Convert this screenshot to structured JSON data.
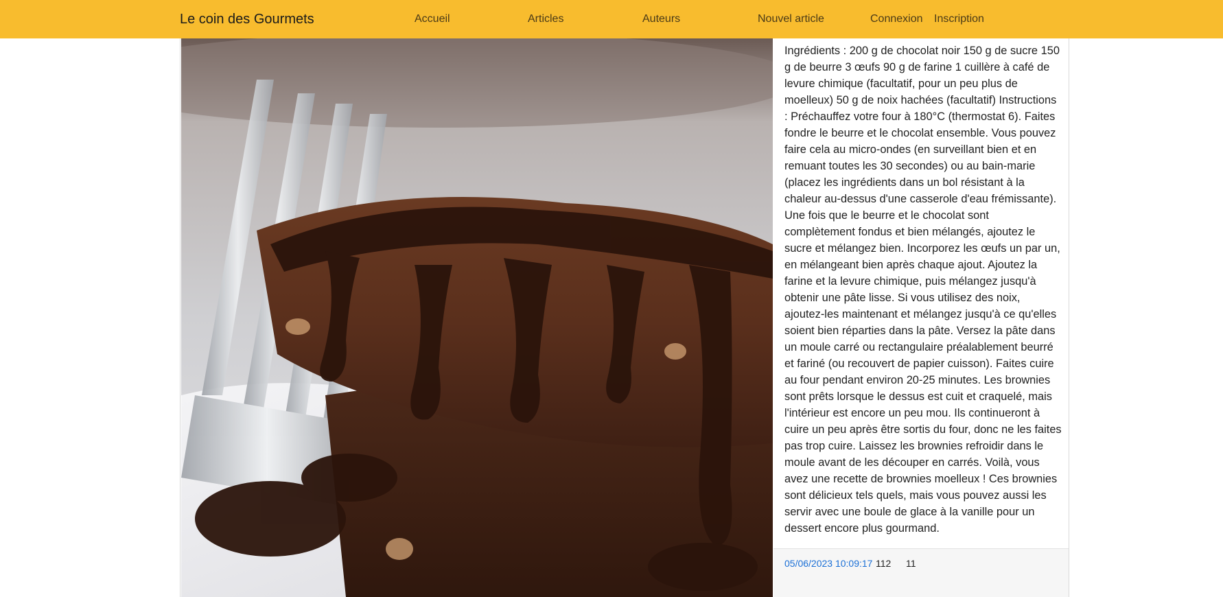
{
  "navbar": {
    "brand": "Le coin des Gourmets",
    "links": [
      {
        "label": "Accueil"
      },
      {
        "label": "Articles"
      },
      {
        "label": "Auteurs"
      },
      {
        "label": "Nouvel article"
      },
      {
        "label": "Connexion"
      },
      {
        "label": "Inscription"
      }
    ],
    "background_color": "#f8bc2e"
  },
  "article": {
    "image": {
      "subject": "chocolate brownies with melted chocolate sauce"
    },
    "body": "Ingrédients : 200 g de chocolat noir 150 g de sucre 150 g de beurre 3 œufs 90 g de farine 1 cuillère à café de levure chimique (facultatif, pour un peu plus de moelleux) 50 g de noix hachées (facultatif) Instructions : Préchauffez votre four à 180°C (thermostat 6). Faites fondre le beurre et le chocolat ensemble. Vous pouvez faire cela au micro-ondes (en surveillant bien et en remuant toutes les 30 secondes) ou au bain-marie (placez les ingrédients dans un bol résistant à la chaleur au-dessus d'une casserole d'eau frémissante). Une fois que le beurre et le chocolat sont complètement fondus et bien mélangés, ajoutez le sucre et mélangez bien. Incorporez les œufs un par un, en mélangeant bien après chaque ajout. Ajoutez la farine et la levure chimique, puis mélangez jusqu'à obtenir une pâte lisse. Si vous utilisez des noix, ajoutez-les maintenant et mélangez jusqu'à ce qu'elles soient bien réparties dans la pâte. Versez la pâte dans un moule carré ou rectangulaire préalablement beurré et fariné (ou recouvert de papier cuisson). Faites cuire au four pendant environ 20-25 minutes. Les brownies sont prêts lorsque le dessus est cuit et craquelé, mais l'intérieur est encore un peu mou. Ils continueront à cuire un peu après être sortis du four, donc ne les faites pas trop cuire. Laissez les brownies refroidir dans le moule avant de les découper en carrés. Voilà, vous avez une recette de brownies moelleux ! Ces brownies sont délicieux tels quels, mais vous pouvez aussi les servir avec une boule de glace à la vanille pour un dessert encore plus gourmand.",
    "footer": {
      "date": "05/06/2023 10:09:17",
      "stat_1": "112",
      "stat_2": "11"
    },
    "date_color": "#1a6fd6"
  }
}
